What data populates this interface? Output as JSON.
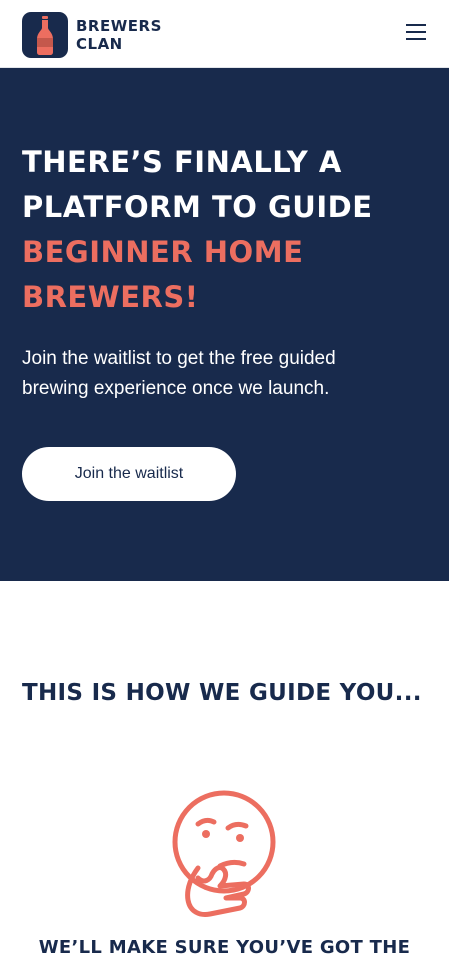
{
  "header": {
    "brand_line1": "BREWERS",
    "brand_line2": "CLAN",
    "logo_icon": "beer-bottle-icon",
    "menu_icon": "hamburger-menu-icon"
  },
  "hero": {
    "title_line1": "THERE’S FINALLY A",
    "title_line2": "PLATFORM TO GUIDE",
    "title_accent_line1": "BEGINNER HOME",
    "title_accent_line2": "BREWERS!",
    "subtitle_line1": "Join the waitlist to get the free guided",
    "subtitle_line2": "brewing experience once we launch.",
    "cta_label": "Join the waitlist"
  },
  "guide": {
    "title": "THIS IS HOW WE GUIDE YOU...",
    "step_icon": "thinking-face-icon",
    "step_text": "WE’LL MAKE SURE YOU’VE GOT THE"
  },
  "colors": {
    "navy": "#182a4c",
    "coral": "#ec6e60",
    "white": "#ffffff"
  }
}
